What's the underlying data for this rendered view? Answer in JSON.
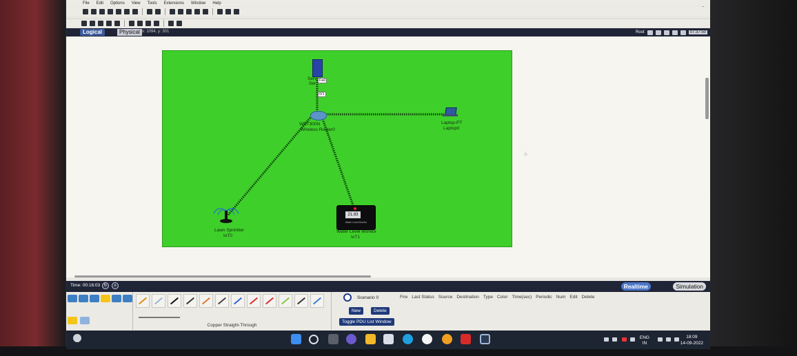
{
  "menu": [
    "File",
    "Edit",
    "Options",
    "View",
    "Tools",
    "Extensions",
    "Window",
    "Help"
  ],
  "help_label": "?",
  "tabs": {
    "logical": "Logical",
    "physical": "Physical",
    "coords": "x: 1094, y: 301"
  },
  "root": {
    "label": "Root",
    "clock": "07:37:50"
  },
  "devices": {
    "server": {
      "name": "Server0",
      "top": "Serv",
      "bottom": "Ser",
      "port": "Fa0"
    },
    "router": {
      "model": "WRT300N",
      "name": "Wireless Router0",
      "port": "0/1"
    },
    "laptop": {
      "model": "Laptop-PT",
      "name": "Laptop0"
    },
    "sprinkler": {
      "model": "Lawn Sprinkler",
      "name": "IoT0"
    },
    "monitor": {
      "reading": "21.83",
      "caption": "Water Level Monitor",
      "model": "Water Level Monitor",
      "name": "IoT1"
    }
  },
  "timebar": {
    "time": "Time: 00:16:03",
    "realtime": "Realtime",
    "simulation": "Simulation"
  },
  "cable_name": "Copper Straight-Through",
  "pdu": {
    "scenario": "Scenario 0",
    "new": "New",
    "delete": "Delete",
    "toggle": "Toggle PDU List Window"
  },
  "pdu_columns": [
    "Fire",
    "Last Status",
    "Source",
    "Destination",
    "Type",
    "Color",
    "Time(sec)",
    "Periodic",
    "Num",
    "Edit",
    "Delete"
  ],
  "taskbar": {
    "lang1": "ENG",
    "lang2": "IN",
    "time": "18:09",
    "date": "14-09-2022"
  },
  "colors": {
    "workspace_green": "#3fcf2a",
    "toolbar_dark": "#1f2436",
    "accent_blue": "#4b76c7"
  }
}
